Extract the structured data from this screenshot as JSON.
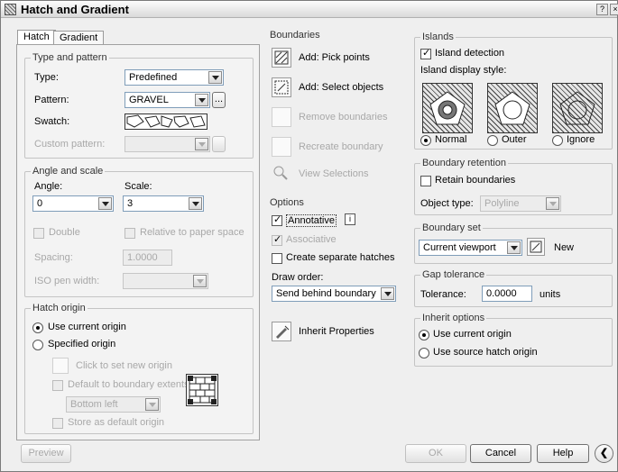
{
  "window": {
    "title": "Hatch and Gradient",
    "help": "?",
    "close": "×"
  },
  "tabs": [
    "Hatch",
    "Gradient"
  ],
  "type_pattern": {
    "group": "Type and pattern",
    "type_label": "Type:",
    "type_value": "Predefined",
    "pattern_label": "Pattern:",
    "pattern_value": "GRAVEL",
    "pattern_browse": "...",
    "swatch_label": "Swatch:",
    "custom_label": "Custom pattern:"
  },
  "angle_scale": {
    "group": "Angle and scale",
    "angle_label": "Angle:",
    "angle_value": "0",
    "scale_label": "Scale:",
    "scale_value": "3",
    "double_label": "Double",
    "relative_label": "Relative to paper space",
    "spacing_label": "Spacing:",
    "spacing_value": "1.0000",
    "iso_label": "ISO pen width:"
  },
  "origin": {
    "group": "Hatch origin",
    "use_current": "Use current origin",
    "specified": "Specified origin",
    "click_set": "Click to set new origin",
    "default_extents": "Default to boundary extents",
    "bottom_left": "Bottom left",
    "store_default": "Store as default origin"
  },
  "boundaries": {
    "group": "Boundaries",
    "add_pick": "Add: Pick points",
    "add_select": "Add: Select objects",
    "remove": "Remove boundaries",
    "recreate": "Recreate boundary",
    "view": "View Selections"
  },
  "options": {
    "group": "Options",
    "annotative": "Annotative",
    "info": "i",
    "associative": "Associative",
    "separate": "Create separate hatches",
    "draw_order_label": "Draw order:",
    "draw_order_value": "Send behind boundary"
  },
  "inherit_props": "Inherit Properties",
  "islands": {
    "group": "Islands",
    "detection": "Island detection",
    "style_label": "Island display style:",
    "normal": "Normal",
    "outer": "Outer",
    "ignore": "Ignore"
  },
  "retention": {
    "group": "Boundary retention",
    "retain": "Retain boundaries",
    "object_type_label": "Object type:",
    "object_type_value": "Polyline"
  },
  "boundary_set": {
    "group": "Boundary set",
    "value": "Current viewport",
    "new": "New"
  },
  "gap": {
    "group": "Gap tolerance",
    "tolerance_label": "Tolerance:",
    "tolerance_value": "0.0000",
    "units": "units"
  },
  "inherit_options": {
    "group": "Inherit options",
    "use_current": "Use current origin",
    "use_source": "Use source hatch origin"
  },
  "footer": {
    "preview": "Preview",
    "ok": "OK",
    "cancel": "Cancel",
    "help": "Help",
    "more": "❮"
  }
}
